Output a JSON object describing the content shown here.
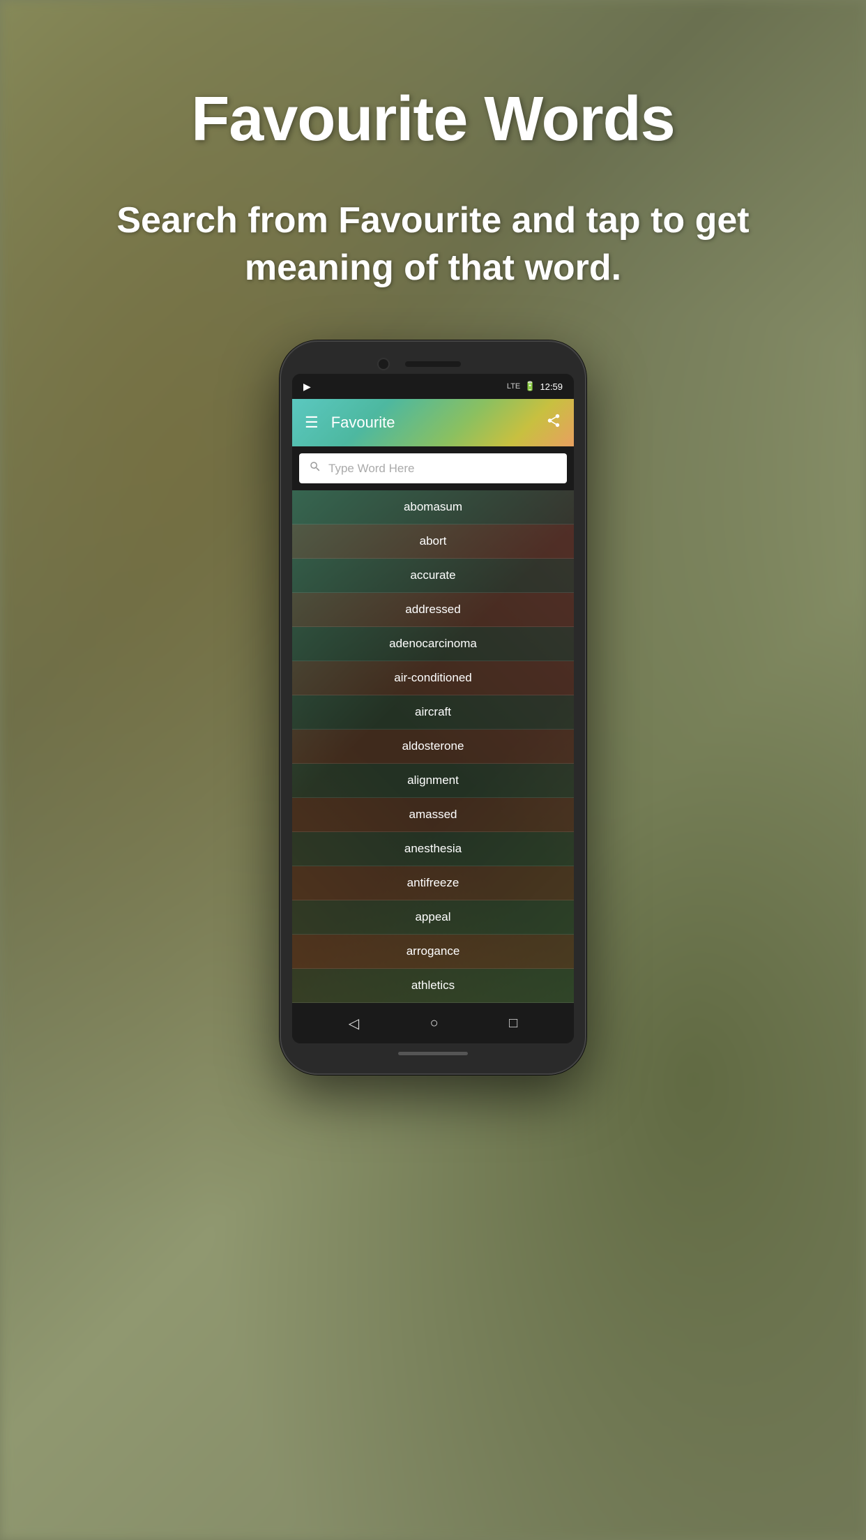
{
  "page": {
    "title": "Favourite Words",
    "subtitle": "Search from Favourite and tap to get meaning of that word."
  },
  "phone": {
    "status_bar": {
      "play_icon": "▶",
      "signal": "LTE",
      "battery": "🔋",
      "time": "12:59"
    },
    "app_bar": {
      "menu_icon": "☰",
      "title": "Favourite",
      "share_icon": "share"
    },
    "search": {
      "placeholder": "Type Word Here",
      "icon": "🔍"
    },
    "words": [
      "abomasum",
      "abort",
      "accurate",
      "addressed",
      "adenocarcinoma",
      "air-conditioned",
      "aircraft",
      "aldosterone",
      "alignment",
      "amassed",
      "anesthesia",
      "antifreeze",
      "appeal",
      "arrogance",
      "athletics"
    ],
    "nav": {
      "back_icon": "◁",
      "home_icon": "○",
      "recent_icon": "□"
    }
  }
}
